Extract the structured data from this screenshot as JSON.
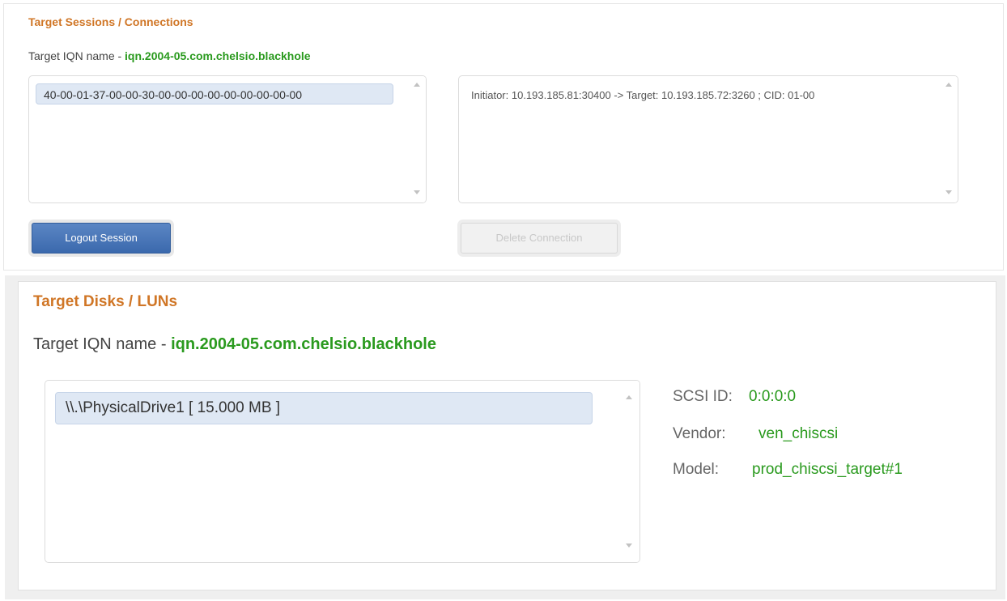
{
  "sessions": {
    "title": "Target Sessions / Connections",
    "iqn_label": "Target IQN name - ",
    "iqn_value": "iqn.2004-05.com.chelsio.blackhole",
    "session_items": [
      "40-00-01-37-00-00-30-00-00-00-00-00-00-00-00-00"
    ],
    "connection_items": [
      "Initiator: 10.193.185.81:30400 -> Target: 10.193.185.72:3260 ; CID: 01-00"
    ],
    "logout_label": "Logout Session",
    "delete_label": "Delete Connection"
  },
  "disks": {
    "title": "Target Disks / LUNs",
    "iqn_label": "Target IQN name - ",
    "iqn_value": "iqn.2004-05.com.chelsio.blackhole",
    "disk_items": [
      "\\\\.\\PhysicalDrive1 [ 15.000 MB ]"
    ],
    "props": {
      "scsi_id_label": "SCSI ID:",
      "scsi_id_value": "0:0:0:0",
      "vendor_label": "Vendor:",
      "vendor_value": "ven_chiscsi",
      "model_label": "Model:",
      "model_value": "prod_chiscsi_target#1"
    }
  },
  "colors": {
    "title_orange": "#d07626",
    "value_green": "#2a9a1e",
    "primary_blue": "#3b69ad",
    "selection_blue": "#dfe8f4"
  }
}
